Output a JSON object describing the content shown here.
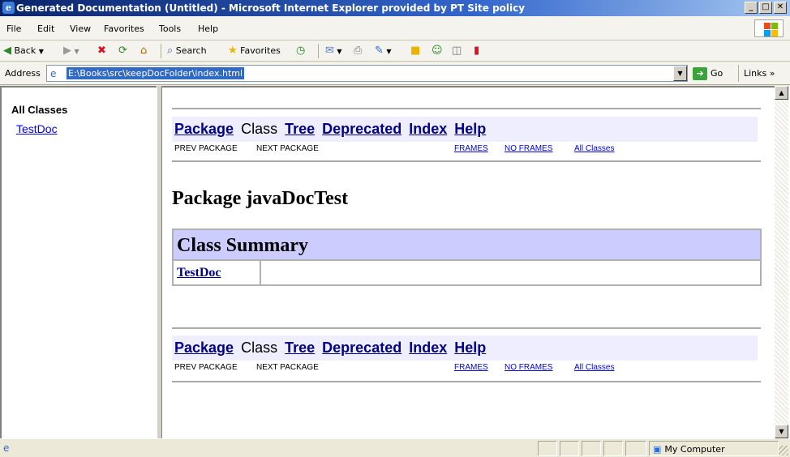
{
  "window": {
    "title": "Generated Documentation (Untitled) - Microsoft Internet Explorer provided by PT Site policy",
    "app_icon": "ie-icon"
  },
  "menu": {
    "items": [
      "File",
      "Edit",
      "View",
      "Favorites",
      "Tools",
      "Help"
    ]
  },
  "toolbar": {
    "back_label": "Back",
    "search_label": "Search",
    "favorites_label": "Favorites"
  },
  "address": {
    "label": "Address",
    "value": "E:\\Books\\src\\keepDocFolder\\index.html",
    "go_label": "Go",
    "links_label": "Links"
  },
  "left_frame": {
    "heading": "All Classes",
    "classes": [
      "TestDoc"
    ]
  },
  "main": {
    "nav": {
      "package": "Package",
      "class": "Class",
      "tree": "Tree",
      "deprecated": "Deprecated",
      "index": "Index",
      "help": "Help",
      "prev_package": "PREV PACKAGE",
      "next_package": "NEXT PACKAGE",
      "frames": "FRAMES",
      "no_frames": "NO FRAMES",
      "all_classes": "All Classes"
    },
    "package_title": "Package javaDocTest",
    "summary_heading": "Class Summary",
    "summary_rows": [
      {
        "name": "TestDoc",
        "description": ""
      }
    ]
  },
  "status": {
    "zone": "My Computer"
  },
  "colors": {
    "nav_bg": "#eeeeff",
    "summary_header_bg": "#ccccff",
    "link": "#0000ee"
  }
}
